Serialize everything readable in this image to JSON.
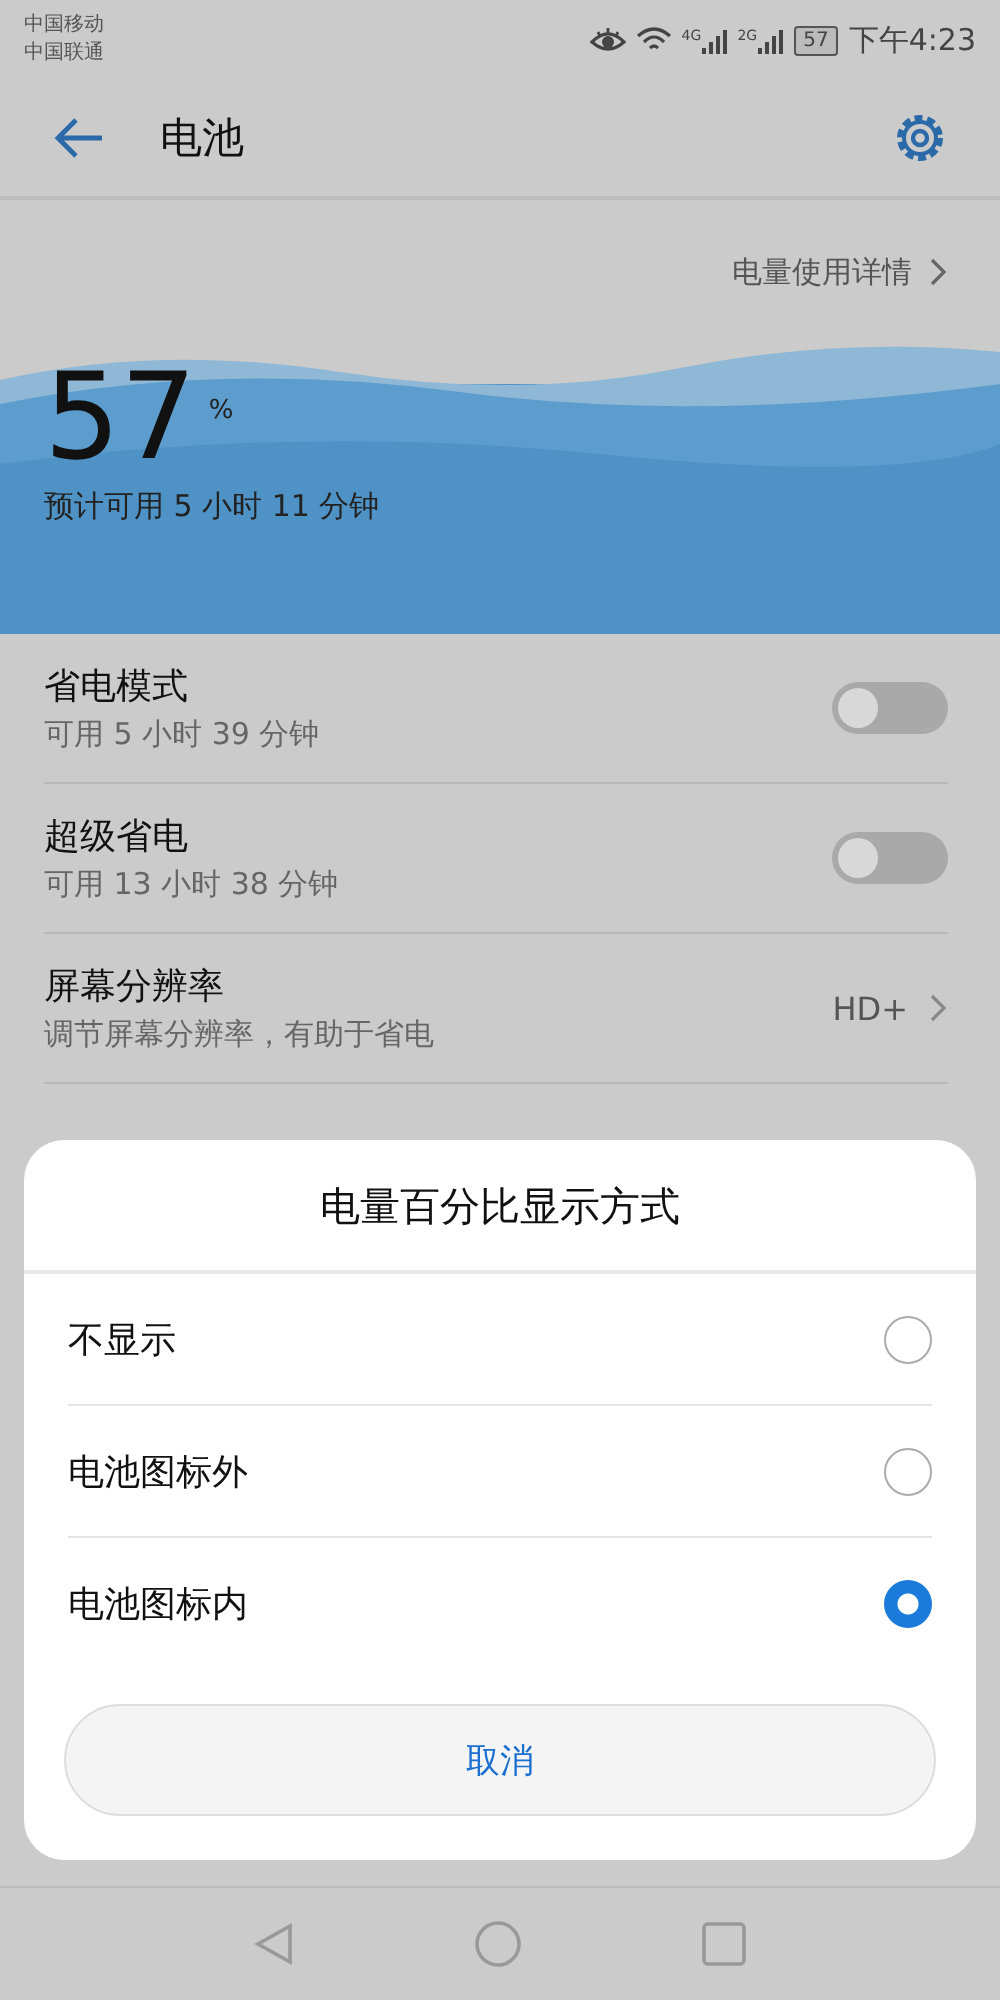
{
  "status_bar": {
    "carriers": [
      "中国移动",
      "中国联通"
    ],
    "networks": [
      "4G",
      "2G"
    ],
    "battery": "57",
    "time": "下午4:23"
  },
  "header": {
    "title": "电池"
  },
  "usage_link": "电量使用详情",
  "battery": {
    "percent": "57",
    "unit": "%",
    "estimate": "预计可用 5 小时 11 分钟"
  },
  "settings": [
    {
      "kind": "toggle",
      "title": "省电模式",
      "subtitle": "可用 5 小时 39 分钟",
      "on": false
    },
    {
      "kind": "toggle",
      "title": "超级省电",
      "subtitle": "可用 13 小时 38 分钟",
      "on": false
    },
    {
      "kind": "value",
      "title": "屏幕分辨率",
      "subtitle": "调节屏幕分辨率，有助于省电",
      "value": "HD+"
    }
  ],
  "dialog": {
    "title": "电量百分比显示方式",
    "options": [
      {
        "label": "不显示",
        "selected": false
      },
      {
        "label": "电池图标外",
        "selected": false
      },
      {
        "label": "电池图标内",
        "selected": true
      }
    ],
    "cancel": "取消"
  }
}
